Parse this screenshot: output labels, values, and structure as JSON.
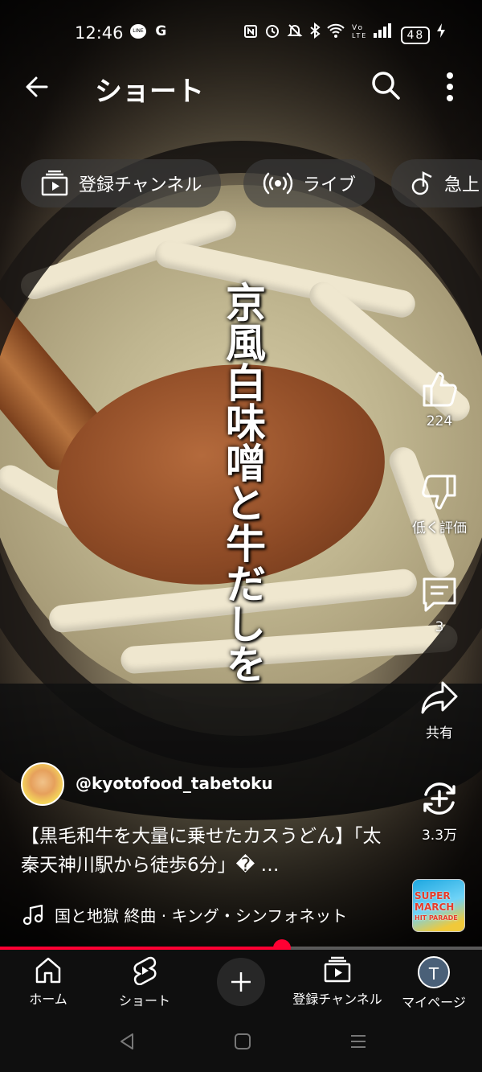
{
  "status_bar": {
    "time": "12:46",
    "left_icons": [
      "line-icon",
      "google-icon"
    ],
    "google_label": "G",
    "line_label": "LINE",
    "right_icons": [
      "nfc-icon",
      "alarm-icon",
      "mute-icon",
      "bluetooth-icon",
      "wifi-icon",
      "volte-icon",
      "signal-icon"
    ],
    "battery": "48"
  },
  "topbar": {
    "title": "ショート"
  },
  "chips": [
    {
      "label": "登録チャンネル",
      "icon": "subscriptions-icon"
    },
    {
      "label": "ライブ",
      "icon": "live-icon"
    },
    {
      "label": "急上",
      "icon": "trending-icon"
    }
  ],
  "caption": "京風白味噌と牛だしを",
  "rail": {
    "like_count": "224",
    "dislike_label": "低く評価",
    "comment_count": "3",
    "share_label": "共有",
    "remix_count": "3.3万"
  },
  "channel": {
    "handle": "@kyotofood_tabetoku"
  },
  "video": {
    "title": "【黒毛和牛を大量に乗せたカスうどん】「太秦天神川駅から徒歩6分」� …"
  },
  "music": {
    "text": "国と地獄 終曲 · キング・シンフォネット",
    "thumb_lines": [
      "SUPER",
      "MARCH",
      "HIT PARADE"
    ]
  },
  "progress": {
    "fraction": 0.585
  },
  "bottom_nav": {
    "home": "ホーム",
    "shorts": "ショート",
    "subscriptions": "登録チャンネル",
    "my_page": "マイページ",
    "avatar_letter": "T"
  },
  "colors": {
    "accent": "#ff0033",
    "nav_bg": "#0f0f0f"
  }
}
